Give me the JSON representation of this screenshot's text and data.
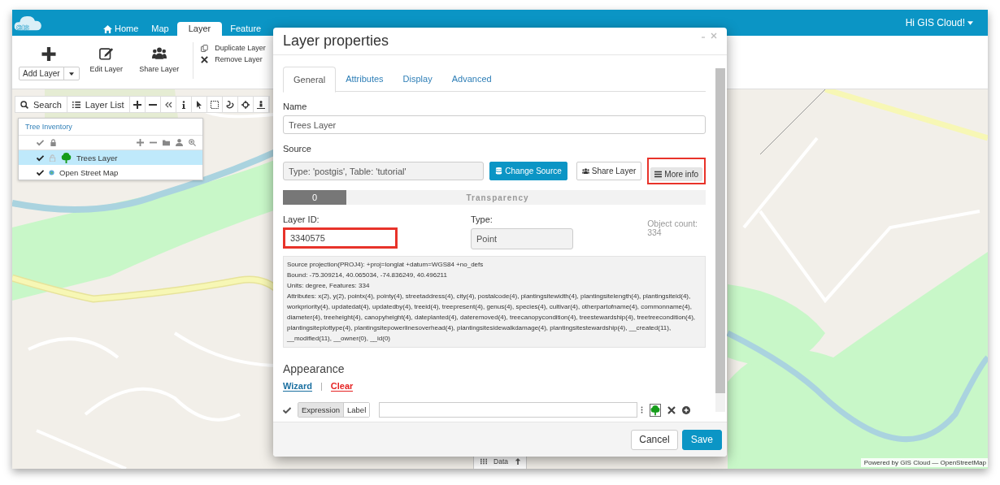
{
  "app": {
    "logo": "GIS",
    "nav": [
      {
        "label": "Home",
        "kind": "home",
        "selected": false
      },
      {
        "label": "Map",
        "kind": "plain",
        "selected": false
      },
      {
        "label": "Layer",
        "kind": "plain",
        "selected": true
      },
      {
        "label": "Feature",
        "kind": "plain",
        "selected": false
      }
    ],
    "user_menu": "Hi GIS Cloud!"
  },
  "ribbon": {
    "add_layer": "Add Layer",
    "edit_layer": "Edit Layer",
    "share_layer": "Share Layer",
    "duplicate_layer": "Duplicate Layer",
    "remove_layer": "Remove Layer"
  },
  "map_toolbar": {
    "search": "Search",
    "layer_list": "Layer List"
  },
  "layer_panel": {
    "title": "Tree Inventory",
    "layers": [
      {
        "name": "Trees Layer",
        "kind": "tree",
        "checked": true,
        "locked": false,
        "selected": true
      },
      {
        "name": "Open Street Map",
        "kind": "globe",
        "checked": true,
        "selected": false
      }
    ]
  },
  "data_tab": "Data",
  "attribution": "Powered by GIS Cloud — OpenStreetMap",
  "dialog": {
    "title": "Layer properties",
    "tabs": [
      {
        "label": "General",
        "selected": true
      },
      {
        "label": "Attributes",
        "selected": false
      },
      {
        "label": "Display",
        "selected": false
      },
      {
        "label": "Advanced",
        "selected": false
      }
    ],
    "name_label": "Name",
    "name_value": "Trees Layer",
    "source_label": "Source",
    "source_value": "Type: 'postgis', Table: 'tutorial'",
    "buttons": [
      {
        "label": "Change Source",
        "kind": "primary",
        "highlighted": false
      },
      {
        "label": "Share Layer",
        "kind": "share",
        "highlighted": false
      },
      {
        "label": "More info",
        "kind": "info",
        "highlighted": true
      }
    ],
    "transparency": {
      "reading": "0",
      "label": "Transparency",
      "level": 0.15
    },
    "layer_id": {
      "label": "Layer ID:",
      "value": "3340575",
      "highlighted": true
    },
    "type": {
      "label": "Type:",
      "value": "Point"
    },
    "object_count": {
      "label": "Object count:",
      "value": "334"
    },
    "info_lines": [
      "Source projection(PROJ4): +proj=longlat +datum=WGS84 +no_defs",
      "Bound: -75.309214, 40.065034, -74.836249, 40.496211",
      "Units: degree, Features: 334",
      "Attributes: x(2), y(2), pointx(4), pointy(4), streetaddress(4), city(4), postalcode(4), plantingsitewidth(4), plantingsitelength(4), plantingsiteid(4), workpriority(4), updatedat(4), updatedby(4), treeid(4), treepresent(4), genus(4), species(4), cultivar(4), otherpartofname(4), commonname(4), diameter(4), treeheight(4), canopyheight(4), dateplanted(4), dateremoved(4), treecanopycondition(4), treestewardship(4), treetreecondition(4), plantingsiteplottype(4), plantingsitepowerlinesoverhead(4), plantingsitesidewalkdamage(4), plantingsitestewardship(4), __created(11), __modified(11), __owner(0), __id(0)"
    ],
    "appearance": {
      "title": "Appearance",
      "wizard": "Wizard",
      "separator": "|",
      "clear": "Clear",
      "checked": true,
      "modes": [
        {
          "label": "Expression",
          "selected": true
        },
        {
          "label": "Label",
          "selected": false
        }
      ]
    },
    "footer": {
      "cancel": "Cancel",
      "save": "Save"
    }
  }
}
